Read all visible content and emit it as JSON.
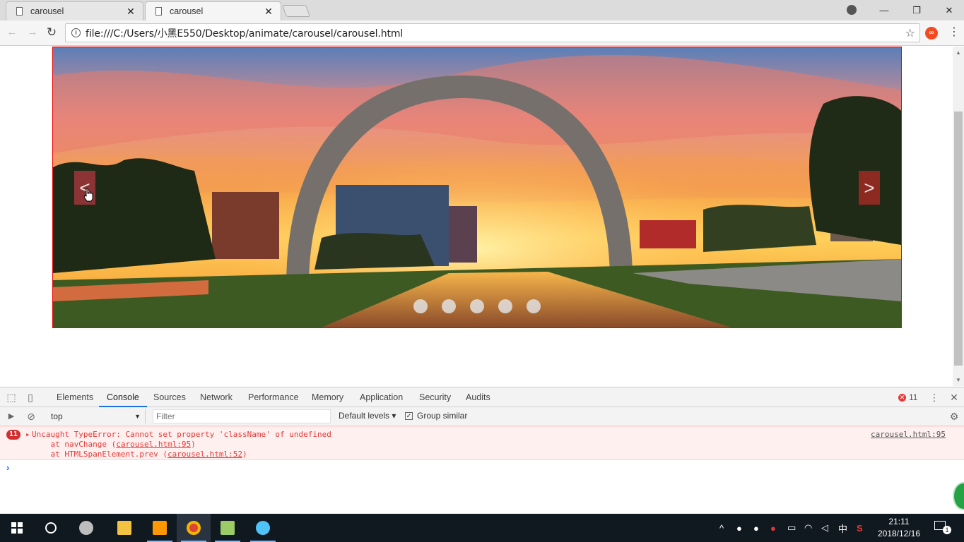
{
  "browser": {
    "tabs": [
      {
        "title": "carousel",
        "active": false
      },
      {
        "title": "carousel",
        "active": true
      }
    ],
    "url": "file:///C:/Users/小黑E550/Desktop/animate/carousel/carousel.html"
  },
  "carousel": {
    "prev_label": "<",
    "next_label": ">",
    "slide_count": 5
  },
  "devtools": {
    "tabs": [
      "Elements",
      "Console",
      "Sources",
      "Network",
      "Performance",
      "Memory",
      "Application",
      "Security",
      "Audits"
    ],
    "active_tab": "Console",
    "error_badge_count": "11",
    "context": "top",
    "filter_placeholder": "Filter",
    "levels": "Default levels",
    "group_similar": "Group similar",
    "error": {
      "count": "11",
      "message": "Uncaught TypeError: Cannot set property 'className' of undefined",
      "stack": [
        {
          "prefix": "    at navChange (",
          "link": "carousel.html:95",
          "suffix": ")"
        },
        {
          "prefix": "    at HTMLSpanElement.prev (",
          "link": "carousel.html:52",
          "suffix": ")"
        }
      ],
      "source": "carousel.html:95"
    },
    "prompt": "›"
  },
  "taskbar": {
    "time": "21:11",
    "date": "2018/12/16",
    "ime": "中",
    "notification_count": "1"
  },
  "colors": {
    "carousel_border": "#ee0000",
    "error_bg": "#fff0f0",
    "error_text": "#e53935",
    "devtools_accent": "#1a73e8"
  }
}
